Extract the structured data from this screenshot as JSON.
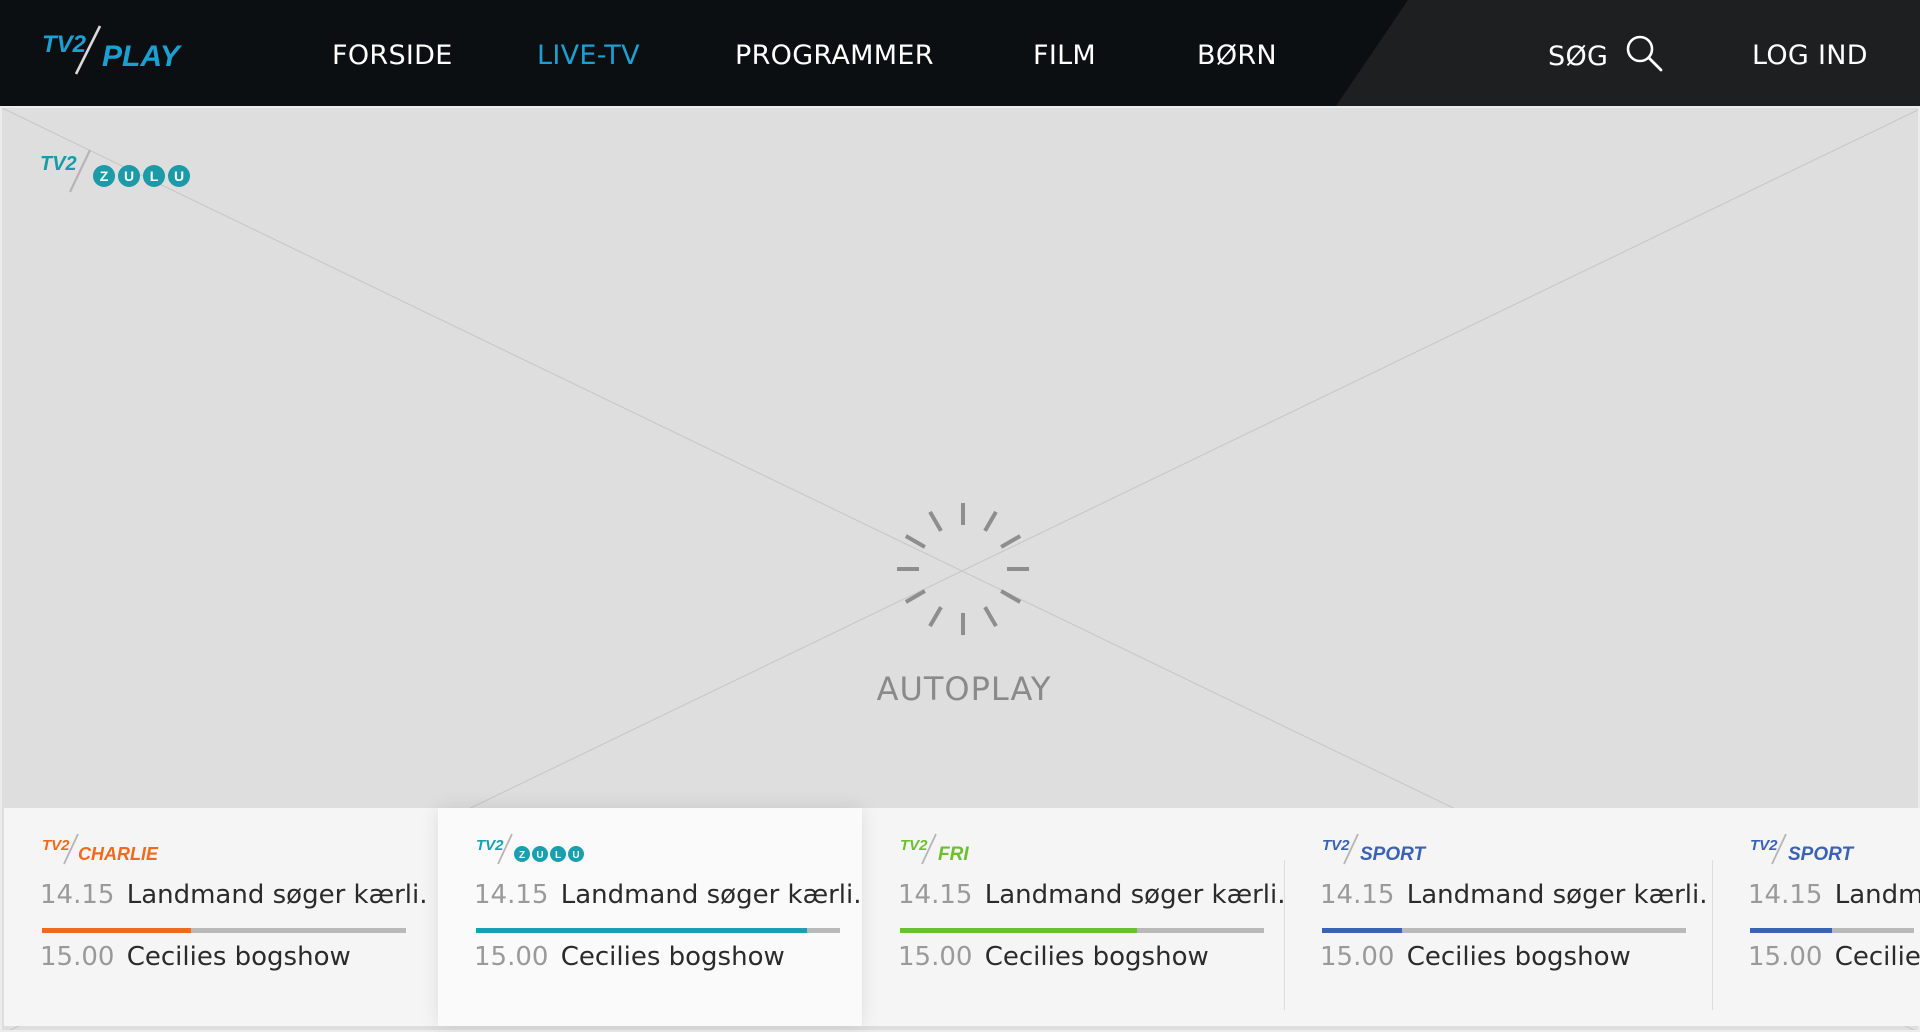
{
  "accent": "#1ba0d3",
  "nav": {
    "logo_text": "PLAY",
    "items": [
      {
        "label": "FORSIDE",
        "active": false
      },
      {
        "label": "LIVE-TV",
        "active": true
      },
      {
        "label": "PROGRAMMER",
        "active": false
      },
      {
        "label": "FILM",
        "active": false
      },
      {
        "label": "BØRN",
        "active": false
      }
    ],
    "search_label": "SØG",
    "search_icon": "search-icon",
    "login_label": "LOG IND"
  },
  "player": {
    "channel_bug": "zulu",
    "status_label": "AUTOPLAY",
    "spinner_icon": "loading-spinner-icon"
  },
  "channels": [
    {
      "logo": "CHARLIE",
      "color": "#ef6a1d",
      "now_time": "14.15",
      "now_title": "Landmand søger kærli...",
      "next_time": "15.00",
      "next_title": "Cecilies bogshow",
      "progress": 0.41,
      "focused": false
    },
    {
      "logo": "zulu",
      "color": "#18a0b1",
      "now_time": "14.15",
      "now_title": "Landmand søger kærli...",
      "next_time": "15.00",
      "next_title": "Cecilies bogshow",
      "progress": 0.91,
      "focused": true
    },
    {
      "logo": "FRI",
      "color": "#6cc02d",
      "now_time": "14.15",
      "now_title": "Landmand søger kærli...",
      "next_time": "15.00",
      "next_title": "Cecilies bogshow",
      "progress": 0.65,
      "focused": false
    },
    {
      "logo": "SPORT",
      "color": "#3a63b4",
      "now_time": "14.15",
      "now_title": "Landmand søger kærli...",
      "next_time": "15.00",
      "next_title": "Cecilies bogshow",
      "progress": 0.22,
      "focused": false
    },
    {
      "logo": "SPORT",
      "color": "#3a63b4",
      "now_time": "14.15",
      "now_title": "Landma",
      "next_time": "15.00",
      "next_title": "Cecilies",
      "progress": 0.5,
      "focused": false
    }
  ]
}
